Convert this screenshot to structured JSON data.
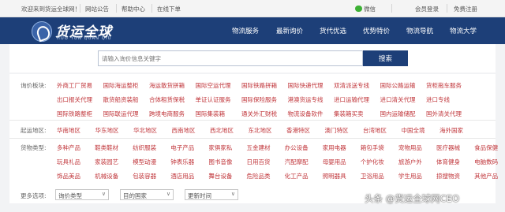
{
  "topbar": {
    "welcome": "欢迎来到货运全球网！",
    "links": [
      "网站公告",
      "帮助中心",
      "在线下单"
    ],
    "wechat": "微信",
    "login": "会员登录",
    "register": "免费注册",
    "wechat_color": "#3cb034"
  },
  "header": {
    "logo_text": "货运全球",
    "logo_sub": "HUO YUN QUAN QIU",
    "nav": [
      "物流服务",
      "最新询价",
      "货代优选",
      "优势特价",
      "物流导航",
      "物流大学"
    ],
    "bg_color": "#1d3f78"
  },
  "search": {
    "placeholder": "请输入询价信息关键字",
    "button": "搜索"
  },
  "filters": {
    "label_color": "#c0353a",
    "price_label": "询价板块:",
    "price_tags": [
      [
        "外商工厂贸易",
        "国际海运整柜",
        "海运散货拼箱",
        "国际空运代理",
        "国际铁路拼箱",
        "国际快递代理",
        "双清派送专线",
        "国际公路运输",
        "货柜拖车服务"
      ],
      [
        "出口报关代理",
        "散货船资装船",
        "合体租赁保税",
        "单证认证服务",
        "国际保险服务",
        "港澳货运专线",
        "进口运输代理",
        "进口清关代理",
        "进口专线"
      ],
      [
        "国际铁路整柜",
        "国际联运代理",
        "跨境电商服务",
        "国际集装箱",
        "通关外汇财税",
        "物流设备软件",
        "集装箱买卖",
        "国内运输储配",
        "国外清关代理"
      ]
    ],
    "region_label": "起运地区:",
    "regions": [
      "华南地区",
      "华东地区",
      "华北地区",
      "西南地区",
      "西北地区",
      "东北地区",
      "香港特区",
      "澳门特区",
      "台湾地区",
      "中国全境",
      "海外国家"
    ],
    "goods_label": "货物类型:",
    "goods": [
      [
        "多种产品",
        "鞋类鞋材",
        "纺织服装",
        "电子产品",
        "家俱家私",
        "五金建材",
        "办公设备",
        "家用电器",
        "箱包手袋",
        "宠物用品",
        "医疗器械",
        "食品保健"
      ],
      [
        "玩具礼品",
        "家装园艺",
        "模型动漫",
        "钟表乐器",
        "图书音像",
        "日用百货",
        "汽配摩配",
        "母婴用品",
        "个护化妆",
        "旅游户外",
        "体育健身",
        "电脑数码"
      ],
      [
        "饰品美品",
        "机械设备",
        "包装容器",
        "酒店用品",
        "舞台设备",
        "危险品类",
        "化工产品",
        "照明器具",
        "卫浴用品",
        "学生用品",
        "掠搜物资",
        "其他产品"
      ]
    ],
    "more_label": "更多选项:",
    "selects": [
      "询价类型",
      "目的国家",
      "更新时间"
    ]
  },
  "watermark": "头条 @货运全球网CEO"
}
